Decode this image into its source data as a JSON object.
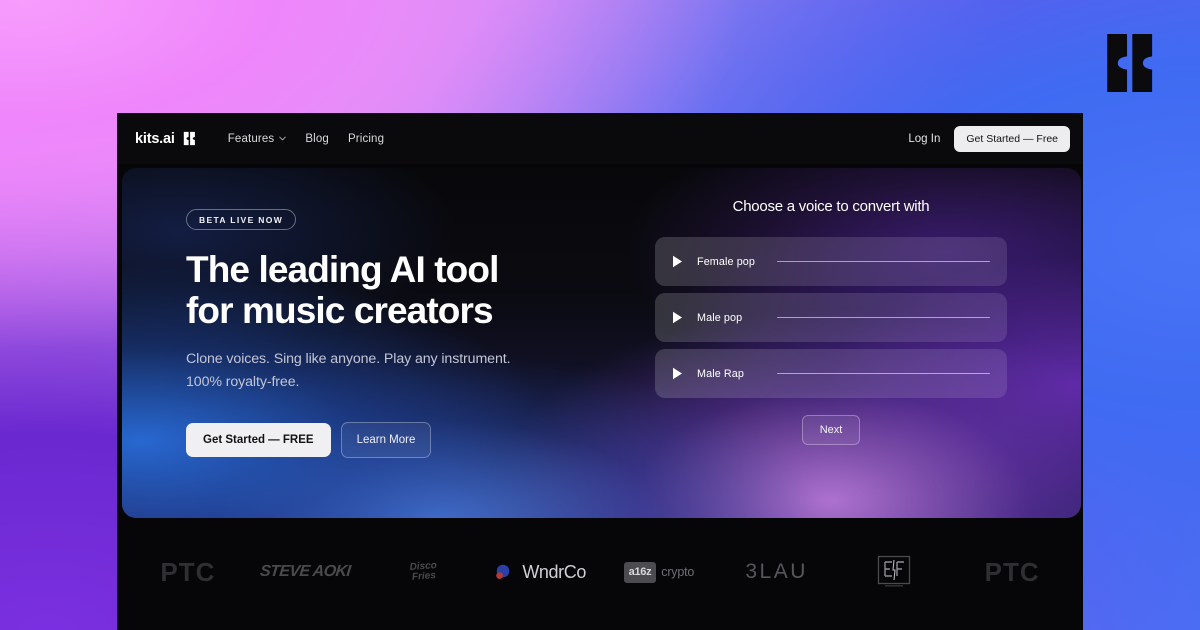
{
  "meta": {
    "watermark_icon": "kits-ai-logo-mark",
    "background_colors": {
      "top_left_pink": "#ef86fb",
      "right_blue": "#4270f5",
      "bottom_left_purple": "#6a28d0"
    }
  },
  "navbar": {
    "brand": "kits.ai",
    "brand_mark_icon": "kits-ai-logo-mark",
    "links": [
      {
        "label": "Features",
        "has_chevron": true,
        "icon": "chevron-down-icon"
      },
      {
        "label": "Blog",
        "has_chevron": false
      },
      {
        "label": "Pricing",
        "has_chevron": false
      }
    ],
    "login_label": "Log In",
    "cta_label": "Get Started — Free"
  },
  "hero": {
    "badge": "BETA LIVE NOW",
    "headline_line1": "The leading AI tool",
    "headline_line2": "for music creators",
    "subhead_line1": "Clone voices. Sing like anyone. Play any instrument.",
    "subhead_line2": "100% royalty-free.",
    "primary_cta": "Get Started — FREE",
    "secondary_cta": "Learn More"
  },
  "voice_picker": {
    "title": "Choose a voice to convert with",
    "play_icon": "play-icon",
    "voices": [
      {
        "label": "Female pop"
      },
      {
        "label": "Male pop"
      },
      {
        "label": "Male Rap"
      }
    ],
    "next_label": "Next"
  },
  "logo_strip": {
    "logos": [
      {
        "type": "text",
        "name": "ptc",
        "text": "PTC"
      },
      {
        "type": "text",
        "name": "steve-aoki",
        "text": "STEVE AOKI"
      },
      {
        "type": "stacked",
        "name": "disco-fries",
        "line1": "Disco",
        "line2": "Fries"
      },
      {
        "type": "mark-text",
        "name": "wndrco",
        "text": "WndrCo",
        "icon": "wndrco-mark-icon"
      },
      {
        "type": "boxed",
        "name": "a16z-crypto",
        "box": "a16z",
        "word": "crypto"
      },
      {
        "type": "text",
        "name": "blau",
        "text": "3LAU"
      },
      {
        "type": "icon",
        "name": "electric-feel",
        "icon": "electric-feel-mark-icon"
      },
      {
        "type": "text",
        "name": "ptc-repeat",
        "text": "PTC"
      }
    ]
  }
}
